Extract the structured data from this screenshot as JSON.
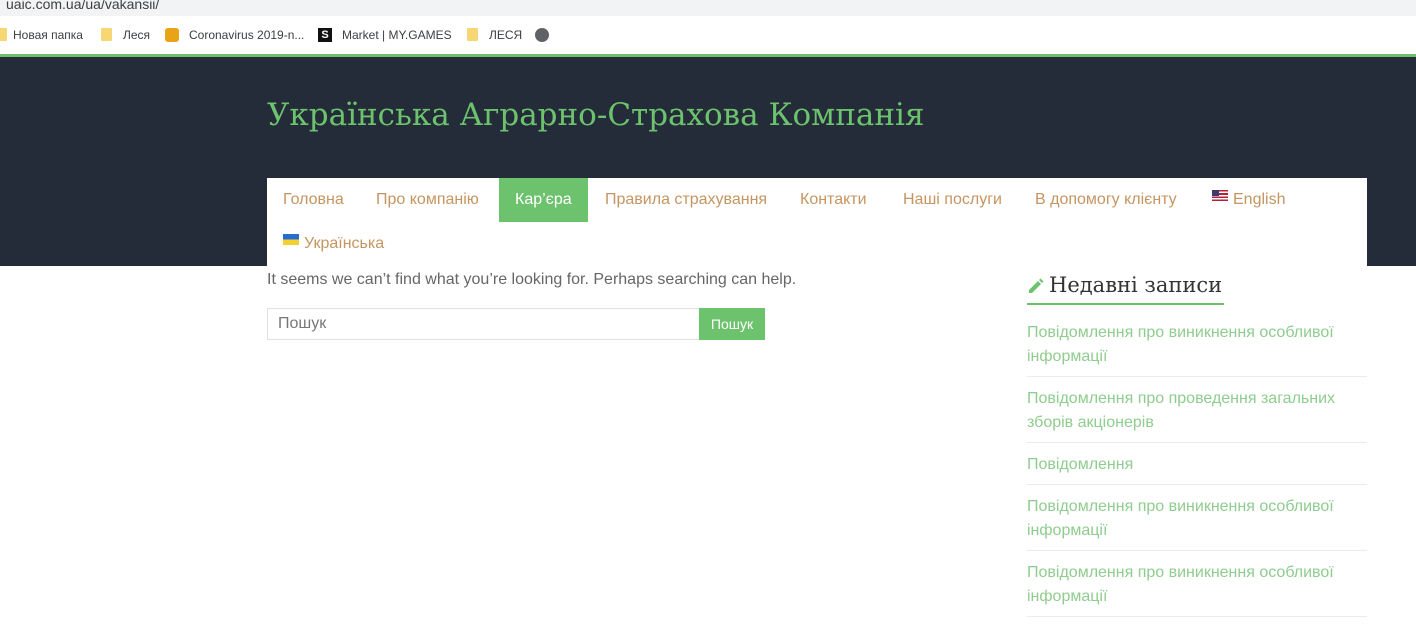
{
  "browser": {
    "url": "uaic.com.ua/ua/vakansii/",
    "bookmarks": [
      {
        "label": "Новая папка",
        "icon": "folder-icon"
      },
      {
        "label": "Леся",
        "icon": "folder-icon"
      },
      {
        "label": "Coronavirus 2019-n...",
        "icon": "shield-icon"
      },
      {
        "label": "Market | MY.GAMES",
        "icon": "s-logo-icon"
      },
      {
        "label": "ЛЕСЯ",
        "icon": "folder-icon"
      },
      {
        "label": "",
        "icon": "globe-icon"
      }
    ]
  },
  "site": {
    "title": "Українська Аграрно-Страхова Компанія",
    "accent_color": "#6dc26d",
    "header_bg": "#232c38",
    "link_color": "#c59561"
  },
  "nav": {
    "items": [
      {
        "label": "Головна",
        "active": false
      },
      {
        "label": "Про компанію",
        "active": false
      },
      {
        "label": "Кар’єра",
        "active": true
      },
      {
        "label": "Правила страхування",
        "active": false
      },
      {
        "label": "Контакти",
        "active": false
      },
      {
        "label": "Наші послуги",
        "active": false
      },
      {
        "label": "В допомогу клієнту",
        "active": false
      },
      {
        "label": "English",
        "active": false,
        "flag": "us-flag-icon"
      },
      {
        "label": "Українська",
        "active": false,
        "flag": "ua-flag-icon"
      }
    ]
  },
  "main": {
    "not_found_text": "It seems we can’t find what you’re looking for. Perhaps searching can help.",
    "search": {
      "placeholder": "Пошук",
      "value": "",
      "button_label": "Пошук"
    }
  },
  "sidebar": {
    "widget_title": "Недавні записи",
    "recent_posts": [
      "Повідомлення про виникнення особливої інформації",
      "Повідомлення про проведення загальних зборів акціонерів",
      "Повідомлення",
      "Повідомлення про виникнення особливої інформації",
      "Повідомлення про виникнення особливої інформації"
    ]
  }
}
